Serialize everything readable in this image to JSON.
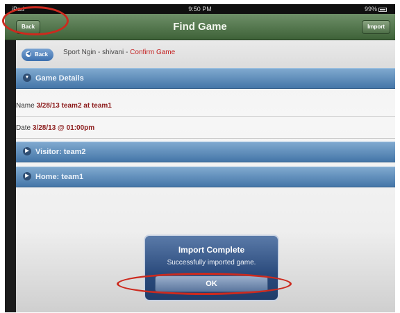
{
  "status_bar": {
    "carrier": "iPad",
    "time": "9:50 PM",
    "battery": "99%"
  },
  "title_bar": {
    "title": "Find Game",
    "back_label": "Back",
    "import_label": "Import"
  },
  "breadcrumb": {
    "back_label": "Back",
    "site": "Sport Ngin - shivani",
    "separator": " - ",
    "current": "Confirm Game"
  },
  "sections": {
    "details": "Game Details",
    "visitor": "Visitor: team2",
    "home": "Home: team1"
  },
  "details": {
    "name_label": "Name ",
    "name_value": "3/28/13 team2 at team1",
    "date_label": "Date ",
    "date_value": "3/28/13 @ 01:00pm"
  },
  "alert": {
    "title": "Import Complete",
    "message": "Successfully imported game.",
    "ok_label": "OK"
  },
  "colors": {
    "title_bar": "#4f7248",
    "section_header": "#5b87b8",
    "value_text": "#8b1a1a",
    "crumb_current": "#c42121",
    "annotation": "#cc2a1e"
  },
  "icons": {
    "section_expanded": "chevron-down-icon",
    "section_collapsed": "chevron-right-icon",
    "crumb_back": "back-arrow-icon"
  }
}
